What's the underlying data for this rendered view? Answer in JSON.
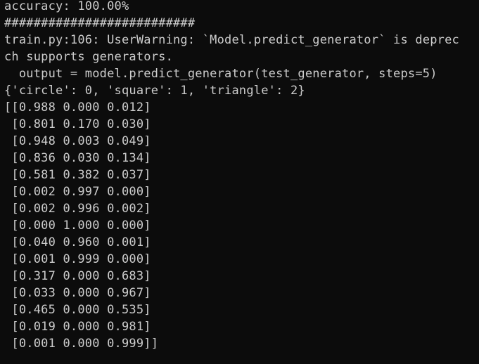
{
  "terminal": {
    "lines": [
      "accuracy: 100.00%",
      "##########################",
      "train.py:106: UserWarning: `Model.predict_generator` is deprec",
      "ch supports generators.",
      "  output = model.predict_generator(test_generator, steps=5)",
      "{'circle': 0, 'square': 1, 'triangle': 2}",
      "[[0.988 0.000 0.012]",
      " [0.801 0.170 0.030]",
      " [0.948 0.003 0.049]",
      " [0.836 0.030 0.134]",
      " [0.581 0.382 0.037]",
      " [0.002 0.997 0.000]",
      " [0.002 0.996 0.002]",
      " [0.000 1.000 0.000]",
      " [0.040 0.960 0.001]",
      " [0.001 0.999 0.000]",
      " [0.317 0.000 0.683]",
      " [0.033 0.000 0.967]",
      " [0.465 0.000 0.535]",
      " [0.019 0.000 0.981]",
      " [0.001 0.000 0.999]]"
    ]
  }
}
